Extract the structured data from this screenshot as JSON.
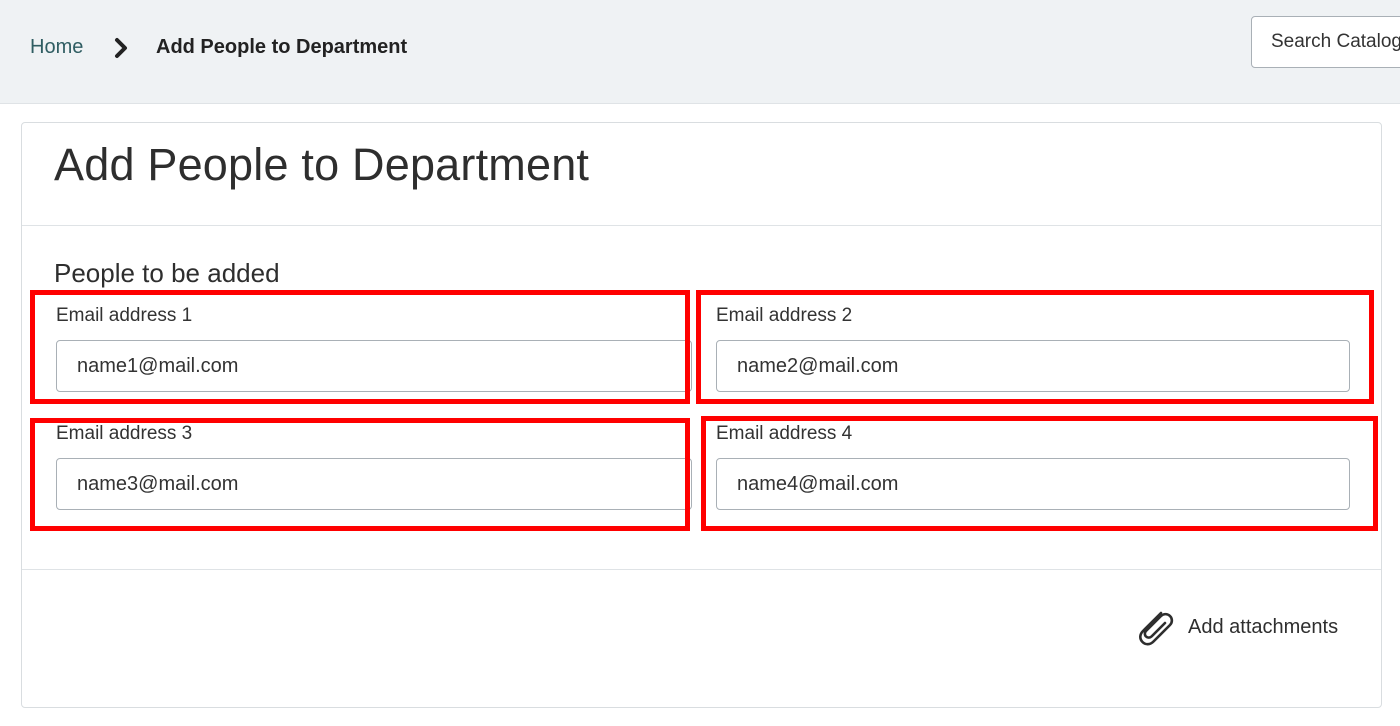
{
  "breadcrumb": {
    "home_label": "Home",
    "current_label": "Add People to Department"
  },
  "search": {
    "placeholder": "Search Catalog"
  },
  "form": {
    "title": "Add People to Department",
    "section_title": "People to be added",
    "fields": [
      {
        "label": "Email address 1",
        "value": "name1@mail.com"
      },
      {
        "label": "Email address 2",
        "value": "name2@mail.com"
      },
      {
        "label": "Email address 3",
        "value": "name3@mail.com"
      },
      {
        "label": "Email address 4",
        "value": "name4@mail.com"
      }
    ],
    "attachments_label": "Add attachments"
  },
  "colors": {
    "highlight": "#ff0000",
    "topbar_bg": "#eff2f4",
    "link": "#2f5d62"
  }
}
